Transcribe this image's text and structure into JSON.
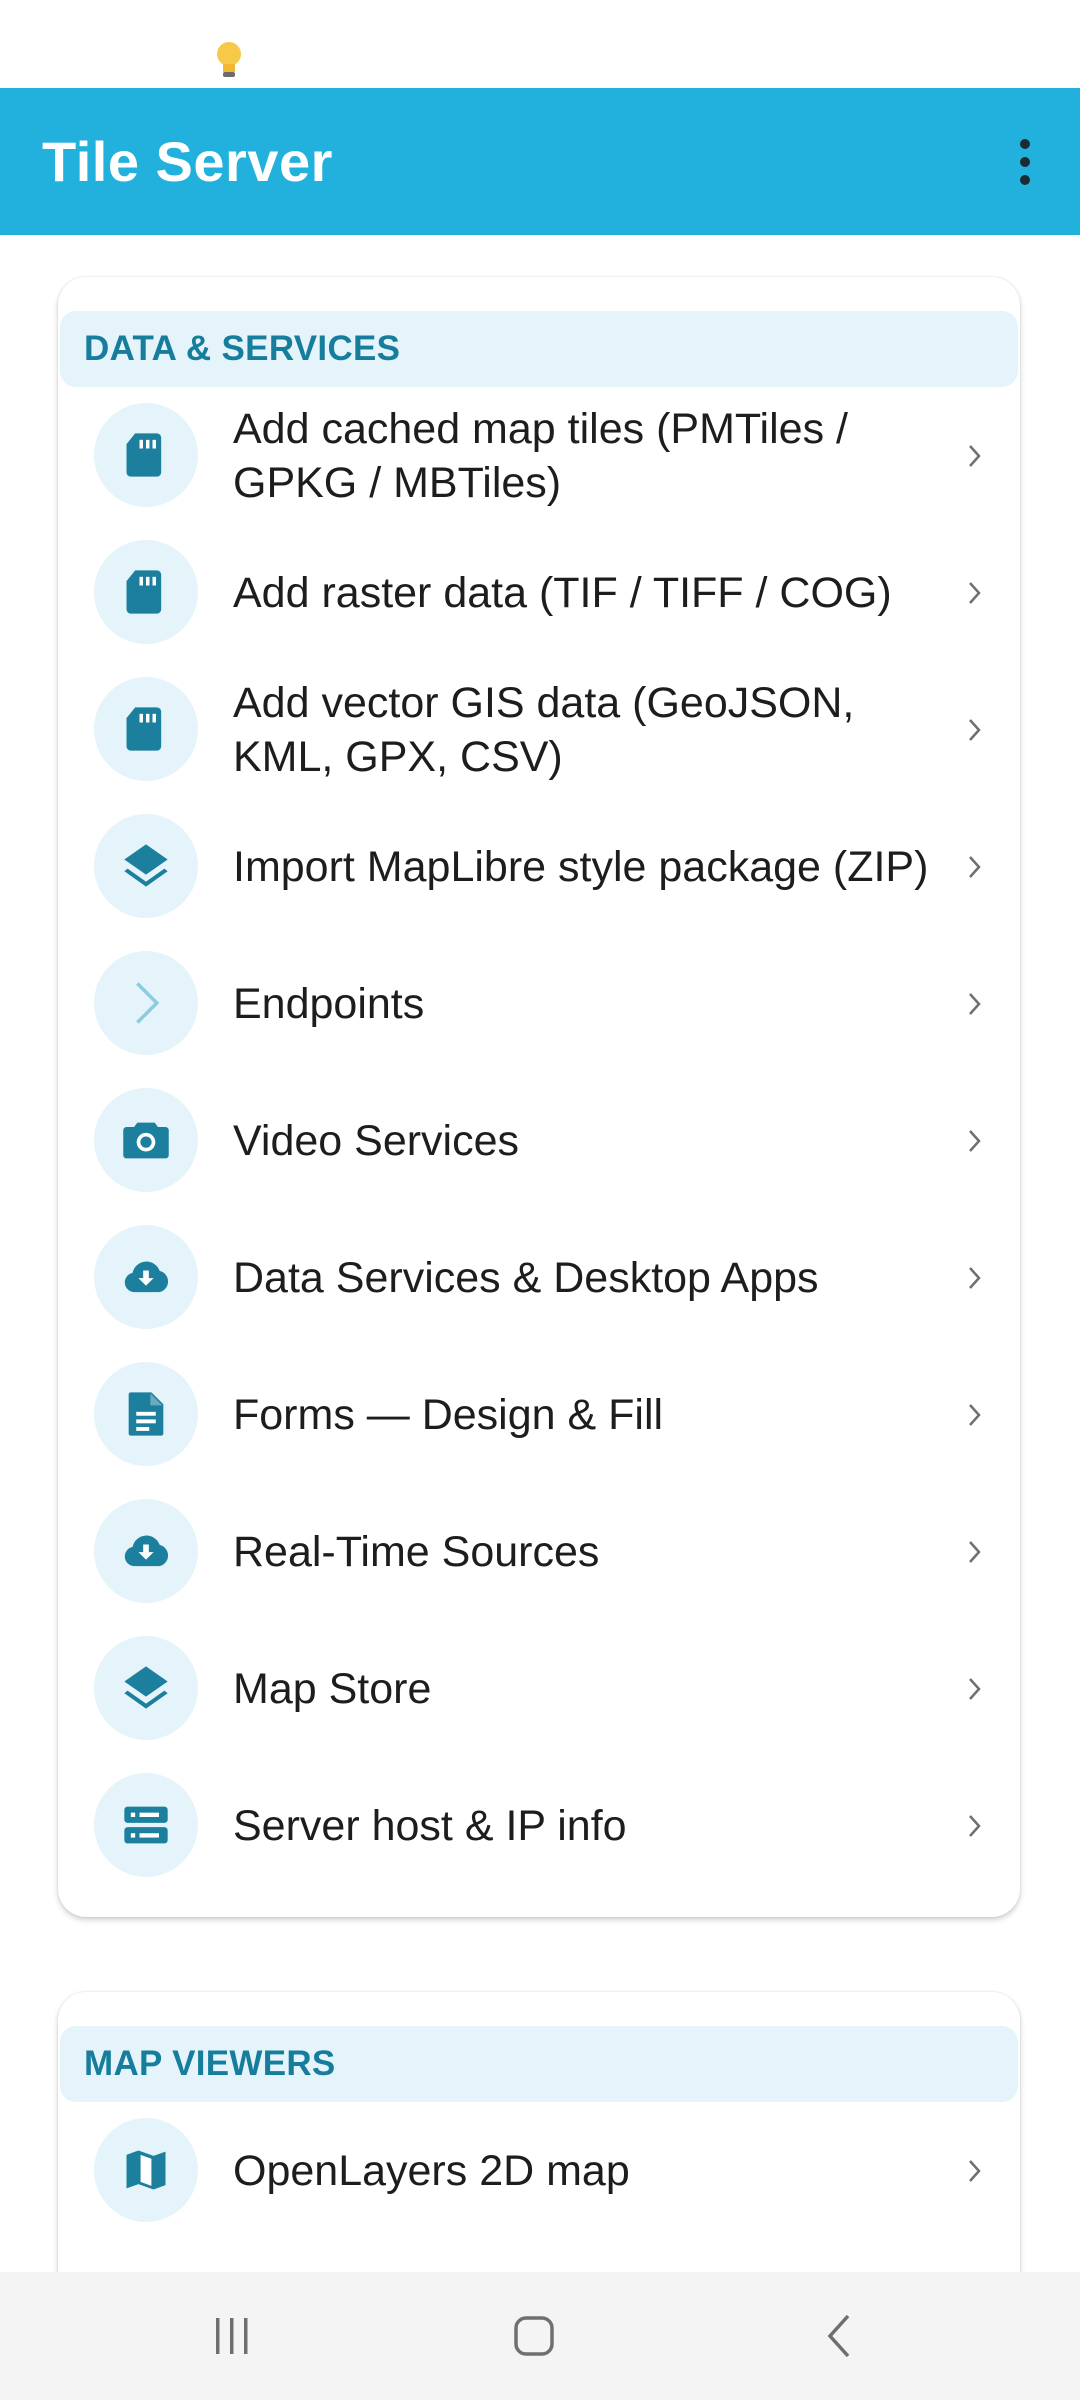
{
  "app": {
    "title": "Tile Server"
  },
  "toolbar": {
    "more_icon": "more-vert-icon"
  },
  "sections": [
    {
      "header": "DATA & SERVICES",
      "items": [
        {
          "label": "Add cached map tiles (PMTiles / GPKG / MBTiles)",
          "icon": "sd-card-icon"
        },
        {
          "label": "Add raster data (TIF / TIFF / COG)",
          "icon": "sd-card-icon"
        },
        {
          "label": "Add vector GIS data (GeoJSON, KML, GPX, CSV)",
          "icon": "sd-card-icon"
        },
        {
          "label": "Import MapLibre style package (ZIP)",
          "icon": "layers-icon"
        },
        {
          "label": "Endpoints",
          "icon": "chevron-right-icon"
        },
        {
          "label": "Video Services",
          "icon": "camera-icon"
        },
        {
          "label": "Data Services & Desktop Apps",
          "icon": "cloud-download-icon"
        },
        {
          "label": "Forms — Design & Fill",
          "icon": "document-icon"
        },
        {
          "label": "Real-Time Sources",
          "icon": "cloud-download-icon"
        },
        {
          "label": "Map Store",
          "icon": "layers-icon"
        },
        {
          "label": "Server host & IP info",
          "icon": "server-icon"
        }
      ]
    },
    {
      "header": "MAP VIEWERS",
      "items": [
        {
          "label": "OpenLayers 2D map",
          "icon": "map-icon"
        }
      ]
    }
  ],
  "colors": {
    "app_bar": "#22b1dc",
    "accent": "#177d9c",
    "icon": "#1d7f9e",
    "section_bg": "#e4f4fa"
  }
}
